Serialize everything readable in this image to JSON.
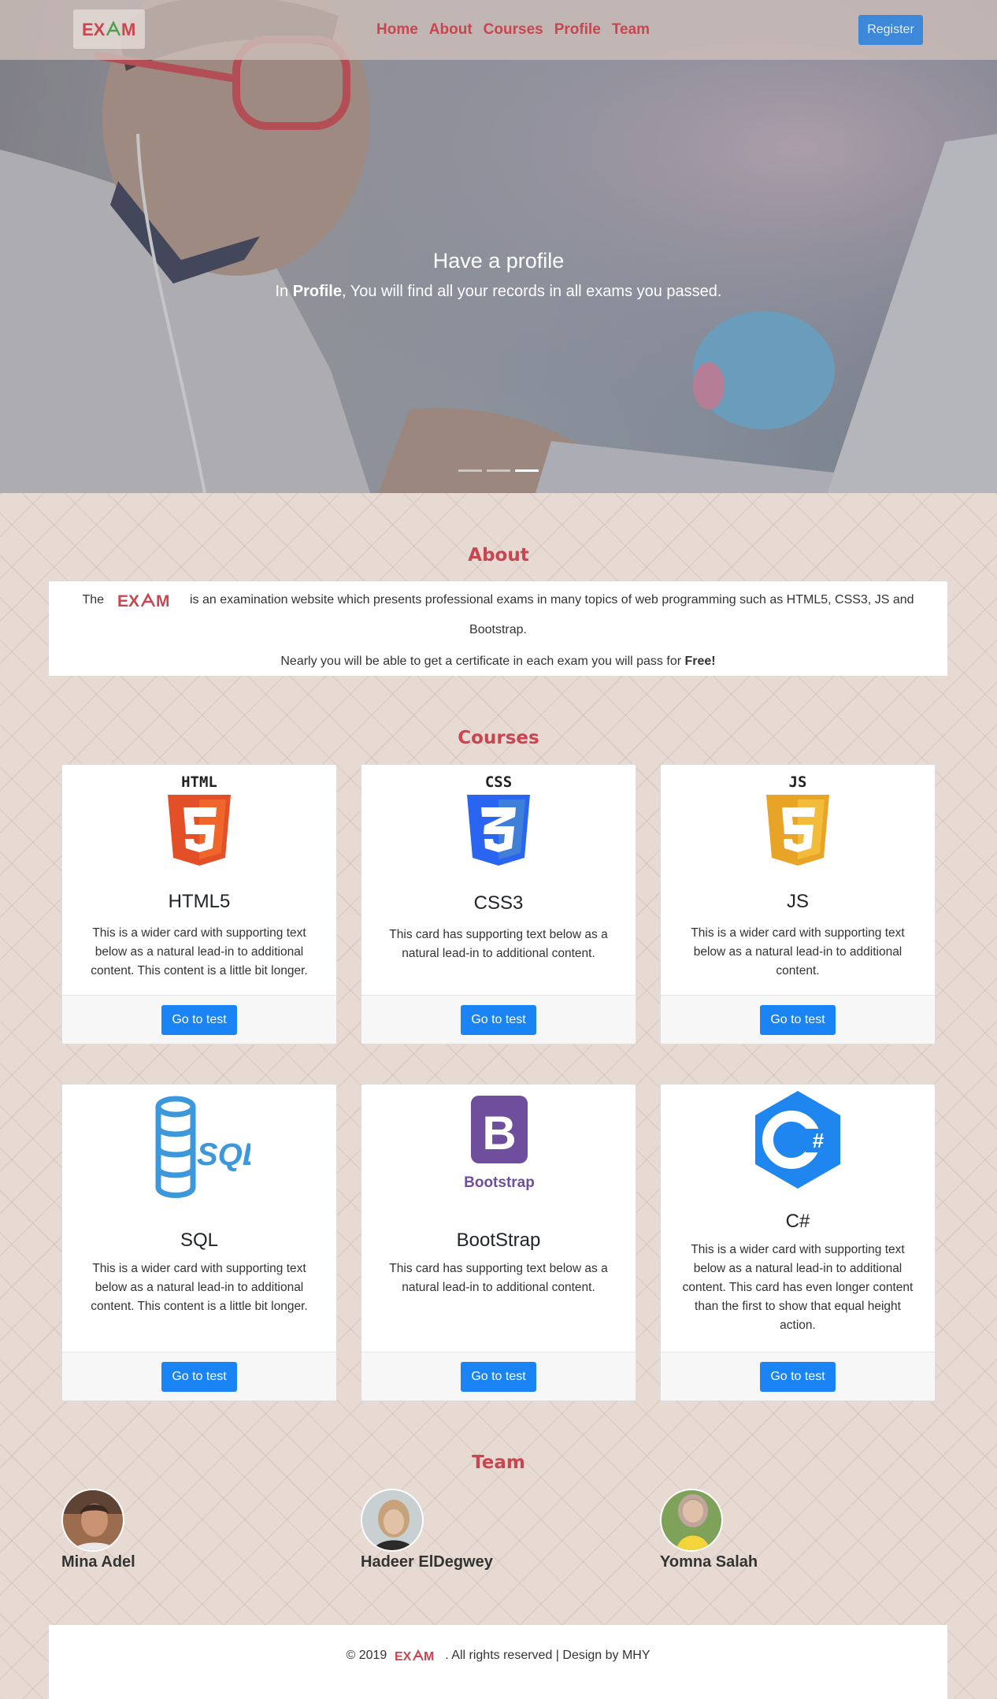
{
  "brand": {
    "logo_text": "EXAM",
    "color": "#c94650"
  },
  "nav": {
    "items": [
      {
        "label": "Home"
      },
      {
        "label": "About"
      },
      {
        "label": "Courses"
      },
      {
        "label": "Profile"
      },
      {
        "label": "Team"
      }
    ],
    "register_label": "Register"
  },
  "hero": {
    "title": "Have a profile",
    "text_prefix": "In ",
    "text_bold": "Profile",
    "text_suffix": ", You will find all your records in all exams you passed."
  },
  "about": {
    "title": "About",
    "line1_prefix": "The",
    "line1_suffix": "is an examination website which presents professional exams in many topics of web programming such as HTML5, CSS3, JS and",
    "line2": "Bootstrap.",
    "line3_prefix": "Nearly you will be able to get a certificate in each exam you will pass for ",
    "line3_bold": "Free!"
  },
  "courses": {
    "title": "Courses",
    "button_label": "Go to test",
    "items": [
      {
        "name": "HTML5",
        "icon": "html5-logo-icon",
        "text": "This is a wider card with supporting text below as a natural lead-in to additional content. This content is a little bit longer."
      },
      {
        "name": "CSS3",
        "icon": "css3-logo-icon",
        "text": "This card has supporting text below as a natural lead-in to additional content."
      },
      {
        "name": "JS",
        "icon": "js-logo-icon",
        "text": "This is a wider card with supporting text below as a natural lead-in to additional content."
      },
      {
        "name": "SQL",
        "icon": "sql-logo-icon",
        "text": "This is a wider card with supporting text below as a natural lead-in to additional content. This content is a little bit longer."
      },
      {
        "name": "BootStrap",
        "icon": "bootstrap-logo-icon",
        "text": "This card has supporting text below as a natural lead-in to additional content."
      },
      {
        "name": "C#",
        "icon": "csharp-logo-icon",
        "text": "This is a wider card with supporting text below as a natural lead-in to additional content. This card has even longer content than the first to show that equal height action."
      }
    ]
  },
  "team": {
    "title": "Team",
    "members": [
      {
        "name": "Mina Adel"
      },
      {
        "name": "Hadeer ElDegwey"
      },
      {
        "name": "Yomna Salah"
      }
    ]
  },
  "footer": {
    "prefix": "© 2019",
    "suffix": ". All rights reserved | Design by MHY"
  }
}
